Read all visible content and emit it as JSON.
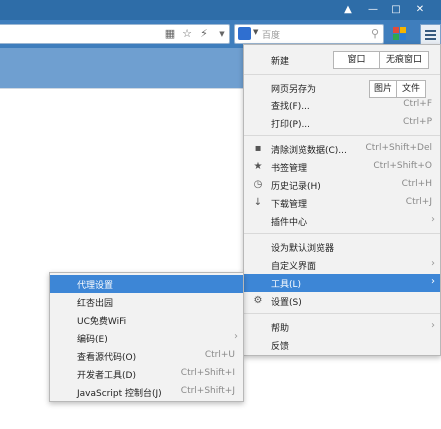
{
  "window": {
    "skin_icon": "shirt-icon",
    "min_icon": "minimize-icon",
    "max_icon": "maximize-icon",
    "close_icon": "close-icon"
  },
  "toolbar": {
    "search_placeholder": "百度",
    "icons": [
      "qr-code-icon",
      "star-icon",
      "lightning-icon",
      "dropdown-icon"
    ]
  },
  "menu": {
    "new_label": "新建",
    "new_window": "窗口",
    "new_incognito": "无痕窗口",
    "save_as": "网页另存为",
    "save_image": "图片",
    "save_file": "文件",
    "find": "查找(F)...",
    "find_sc": "Ctrl+F",
    "print": "打印(P)...",
    "print_sc": "Ctrl+P",
    "clear": "清除浏览数据(C)...",
    "clear_sc": "Ctrl+Shift+Del",
    "bookmarks": "书签管理",
    "bookmarks_sc": "Ctrl+Shift+O",
    "history": "历史记录(H)",
    "history_sc": "Ctrl+H",
    "downloads": "下载管理",
    "downloads_sc": "Ctrl+J",
    "plugins": "插件中心",
    "default_browser": "设为默认浏览器",
    "customize": "自定义界面",
    "tools": "工具(L)",
    "settings": "设置(S)",
    "help": "帮助",
    "feedback": "反馈"
  },
  "submenu": {
    "proxy": "代理设置",
    "red_apricot": "红杏出园",
    "uc_wifi": "UC免费WiFi",
    "encoding": "编码(E)",
    "view_source": "查看源代码(O)",
    "view_source_sc": "Ctrl+U",
    "devtools": "开发者工具(D)",
    "devtools_sc": "Ctrl+Shift+I",
    "js_console": "JavaScript 控制台(J)",
    "js_console_sc": "Ctrl+Shift+J"
  },
  "colors": {
    "titlebar": "#2e6da8",
    "highlight": "#3d86d6",
    "menu_bg": "#f2f2f2"
  }
}
